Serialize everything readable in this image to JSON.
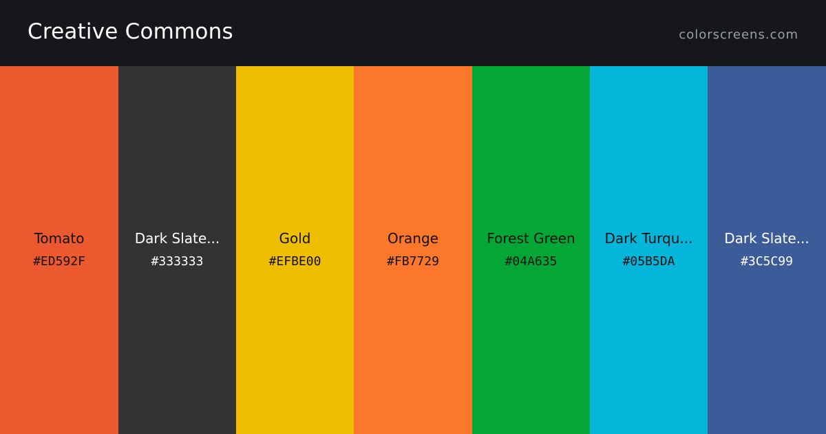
{
  "header": {
    "title": "Creative Commons",
    "site": "colorscreens.com"
  },
  "colors": [
    {
      "name": "Tomato",
      "hex": "#ED592F",
      "text_color": "#111111"
    },
    {
      "name": "Dark Slate...",
      "hex": "#333333",
      "text_color": "#ffffff"
    },
    {
      "name": "Gold",
      "hex": "#EFBE00",
      "text_color": "#111111"
    },
    {
      "name": "Orange",
      "hex": "#FB7729",
      "text_color": "#111111"
    },
    {
      "name": "Forest Green",
      "hex": "#04A635",
      "text_color": "#111111"
    },
    {
      "name": "Dark Turqu...",
      "hex": "#05B5DA",
      "text_color": "#111111"
    },
    {
      "name": "Dark Slate...",
      "hex": "#3C5C99",
      "text_color": "#ffffff"
    }
  ]
}
